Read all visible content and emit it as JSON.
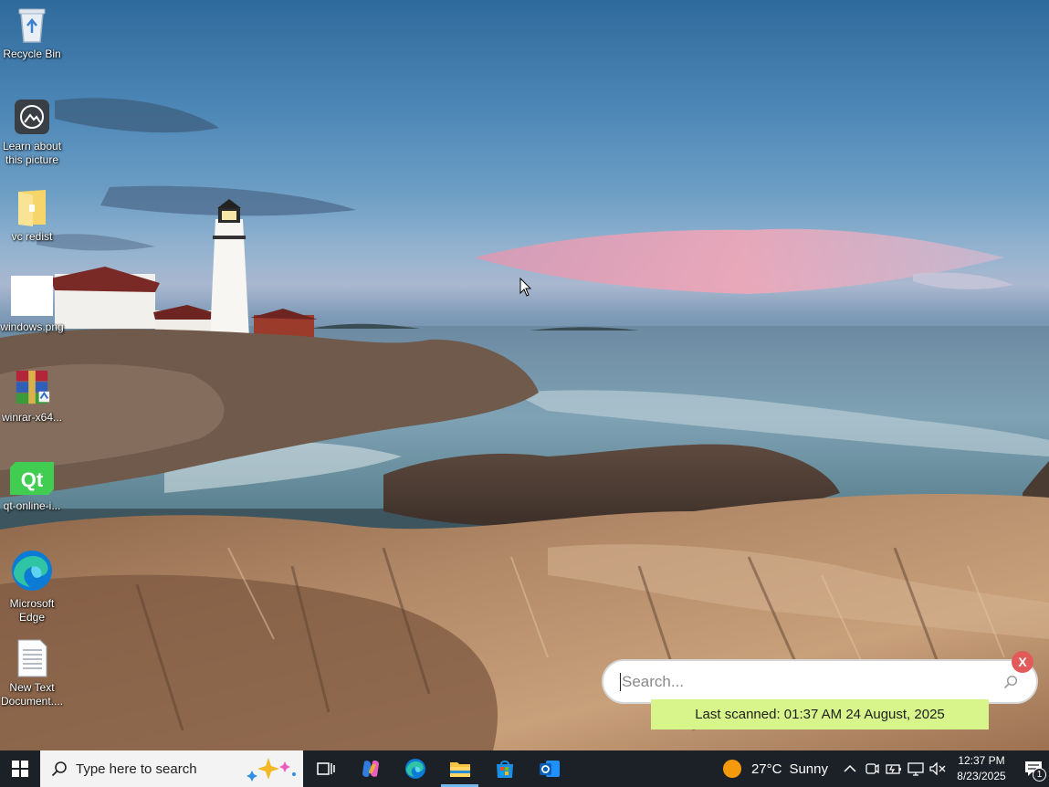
{
  "desktop": {
    "icons": [
      {
        "label": "Recycle Bin",
        "icon": "recycle-bin-icon"
      },
      {
        "label": "Learn about this picture",
        "icon": "camera-icon"
      },
      {
        "label": "vc redist",
        "icon": "folder-icon"
      },
      {
        "label": "windows.png",
        "icon": "image-file-icon"
      },
      {
        "label": "winrar-x64...",
        "icon": "winrar-icon"
      },
      {
        "label": "qt-online-i...",
        "icon": "qt-icon"
      },
      {
        "label": "Microsoft Edge",
        "icon": "edge-icon"
      },
      {
        "label": "New Text Document....",
        "icon": "text-document-icon"
      }
    ]
  },
  "search_widget": {
    "placeholder": "Search...",
    "value": "",
    "close_label": "X",
    "status": "Last scanned: 01:37 AM 24 August, 2025",
    "colors": {
      "status_bg": "#d7f58a",
      "close_bg": "#e25a5a"
    }
  },
  "taskbar": {
    "search_placeholder": "Type here to search",
    "apps": [
      "task-view-icon",
      "copilot-icon",
      "edge-icon",
      "file-explorer-icon",
      "microsoft-store-icon",
      "outlook-icon"
    ],
    "active_app": "file-explorer-icon",
    "weather": {
      "temp": "27°C",
      "condition": "Sunny"
    },
    "tray_icons": [
      "chevron-up-icon",
      "meet-now-icon",
      "battery-icon",
      "network-icon",
      "volume-muted-icon"
    ],
    "time": "12:37 PM",
    "date": "8/23/2025",
    "notification_count": "1",
    "colors": {
      "bar": "#1c2027",
      "accent": "#76b9ed"
    }
  }
}
